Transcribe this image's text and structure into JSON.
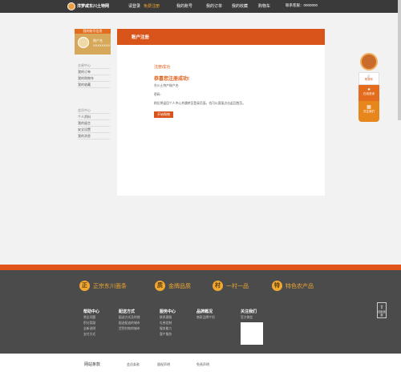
{
  "top": {
    "site_name": "洋梦咸东川土特网",
    "nav": [
      "请登录",
      "免费注册",
      "我的账号",
      "我的订单",
      "我的收藏",
      "购物车"
    ],
    "hotline": "联系客服：0000000"
  },
  "sidebar": {
    "header": "我的账号信息",
    "username": "账户名",
    "user_id": "XXXXXXXX",
    "group1_title": "交易中心",
    "group1": [
      "我的订单",
      "我的购物车",
      "我的收藏"
    ],
    "group2_title": "会员中心",
    "group2": [
      "个人资料",
      "我的留言",
      "安全设置",
      "我的消息"
    ]
  },
  "main": {
    "title": "账户注册",
    "status": "注册成功",
    "headline": "恭喜您注册成功!",
    "account_line": "东川土特产账户名:",
    "password_line": "密码:",
    "hint": "稍后将返回个人中心并跳转至登录页面，也可以直接点击返回首页。",
    "button": "开始购物"
  },
  "floating": {
    "cart": "购物车",
    "service": "在线咨询",
    "qr": "关注我们"
  },
  "footer": {
    "promos": [
      {
        "icon": "正",
        "text": "正宗东川面条"
      },
      {
        "icon": "质",
        "text": "金牌品质"
      },
      {
        "icon": "村",
        "text": "一村一品"
      },
      {
        "icon": "特",
        "text": "特色农产品"
      }
    ],
    "cols": [
      {
        "title": "帮助中心",
        "items": [
          "常见问题",
          "积分奖励",
          "全新说明",
          "支付方式"
        ]
      },
      {
        "title": "配送方式",
        "items": [
          "配送方式及时效",
          "配送配送的城市",
          "货到付款的城市"
        ]
      },
      {
        "title": "服务中心",
        "items": [
          "联系客服",
          "礼券定制",
          "服务能力",
          "客户服务"
        ]
      },
      {
        "title": "品牌概况",
        "items": [
          "商家品牌介绍"
        ]
      },
      {
        "title": "关注我们",
        "items": [
          "官方微信"
        ]
      }
    ],
    "backtop": "回到顶部"
  },
  "bottom": {
    "label": "网站条款",
    "links": [
      "会员条款",
      "版权声明",
      "免责声明"
    ]
  }
}
